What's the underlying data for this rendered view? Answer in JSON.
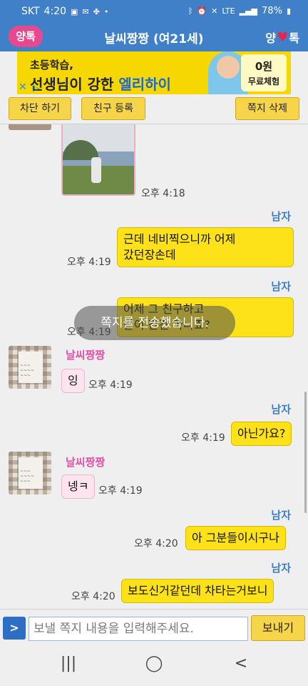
{
  "status_bar": {
    "carrier": "SKT",
    "time": "4:20",
    "battery": "78%",
    "signal_label": "LTE"
  },
  "app_bar": {
    "logo_left": "양톡",
    "title": "날씨짱짱 (여21세)",
    "logo_right_a": "양",
    "logo_right_b": "톡"
  },
  "ad": {
    "line1": "초등학습,",
    "line2_a": "선생님이 강한 ",
    "line2_b": "엘리하이",
    "promo_top": "0원",
    "promo_bottom": "무료체험"
  },
  "toolbar": {
    "block_label": "차단 하기",
    "friend_label": "친구 등록",
    "delete_label": "쪽지 삭제"
  },
  "chat": {
    "photo_time": "오후 4:18",
    "messages": [
      {
        "sender": "남자",
        "text_line1": "근데 네비찍으니까 어제",
        "text_line2": "갔던장손데",
        "time": "오후 4:19"
      },
      {
        "sender": "남자",
        "text_line1": "어제 그 친구하고",
        "text_line2": "같이 간건 아니죠?",
        "time": "오후 4:19"
      },
      {
        "sender": "날씨짱짱",
        "text": "잉",
        "time": "오후 4:19"
      },
      {
        "sender": "남자",
        "text": "아닌가요?",
        "time": "오후 4:19"
      },
      {
        "sender": "날씨짱짱",
        "text": "넹ㅋ",
        "time": "오후 4:19"
      },
      {
        "sender": "남자",
        "text": "아 그분들이시구나",
        "time": "오후 4:20"
      },
      {
        "sender": "남자",
        "text": "보도신거같던데 차타는거보니",
        "time": "오후 4:20"
      }
    ],
    "toast": "쪽지를 전송했습니다."
  },
  "input": {
    "arrow_label": ">",
    "placeholder": "보낼 쪽지 내용을 입력해주세요.",
    "send_label": "보내기"
  },
  "nav": {
    "recents": "|||",
    "home": "◯",
    "back": "<"
  },
  "colors": {
    "accent_blue": "#3f80c8",
    "bubble_yellow": "#fde21a",
    "bubble_pink": "#fde4ef",
    "button_yellow": "#f7d54a",
    "female_name": "#e052a8"
  }
}
